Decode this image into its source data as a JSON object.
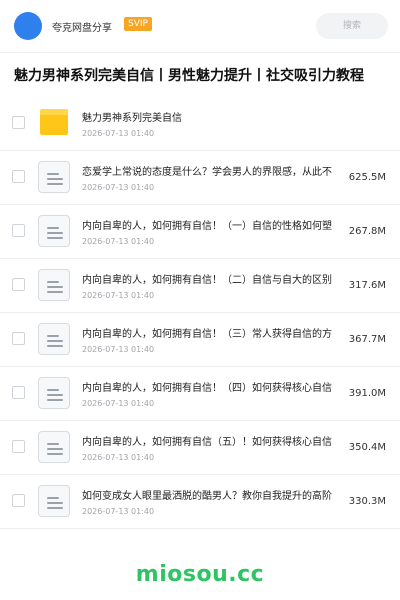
{
  "header": {
    "user_name": "夸克网盘分享",
    "badge": "SVIP",
    "search_label": "搜索"
  },
  "page_title": "魅力男神系列完美自信丨男性魅力提升丨社交吸引力教程",
  "files": [
    {
      "type": "folder",
      "name": "魅力男神系列完美自信",
      "date": "2026-07-13 01:40",
      "size": ""
    },
    {
      "type": "file",
      "name": "恋爱学上常说的态度是什么？学会男人的界限感，从此不",
      "date": "2026-07-13 01:40",
      "size": "625.5M"
    },
    {
      "type": "file",
      "name": "内向自卑的人，如何拥有自信！（一）自信的性格如何塑",
      "date": "2026-07-13 01:40",
      "size": "267.8M"
    },
    {
      "type": "file",
      "name": "内向自卑的人，如何拥有自信！（二）自信与自大的区别",
      "date": "2026-07-13 01:40",
      "size": "317.6M"
    },
    {
      "type": "file",
      "name": "内向自卑的人，如何拥有自信！（三）常人获得自信的方",
      "date": "2026-07-13 01:40",
      "size": "367.7M"
    },
    {
      "type": "file",
      "name": "内向自卑的人，如何拥有自信！（四）如何获得核心自信",
      "date": "2026-07-13 01:40",
      "size": "391.0M"
    },
    {
      "type": "file",
      "name": "内向自卑的人，如何拥有自信（五）！如何获得核心自信",
      "date": "2026-07-13 01:40",
      "size": "350.4M"
    },
    {
      "type": "file",
      "name": "如何变成女人眼里最洒脱的酷男人？教你自我提升的高阶",
      "date": "2026-07-13 01:40",
      "size": "330.3M"
    }
  ],
  "footer": {
    "brand": "miosou.cc"
  },
  "colors": {
    "avatar": "#2f80ed",
    "svip": "#f5a623",
    "folder": "#ffc61a",
    "brand": "#2fc463"
  }
}
